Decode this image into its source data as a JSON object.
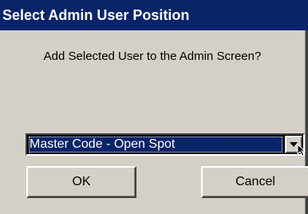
{
  "window": {
    "title": "Select Admin User Position"
  },
  "dialog": {
    "prompt": "Add Selected User to the Admin Screen?"
  },
  "position_select": {
    "selected_value": "Master Code - Open Spot",
    "arrow_icon": "chevron-down-icon"
  },
  "buttons": {
    "ok_label": "OK",
    "cancel_label": "Cancel"
  },
  "colors": {
    "titlebar": "#0a246a",
    "dialog_face": "#d4d0c8",
    "selection": "#0a246a"
  }
}
